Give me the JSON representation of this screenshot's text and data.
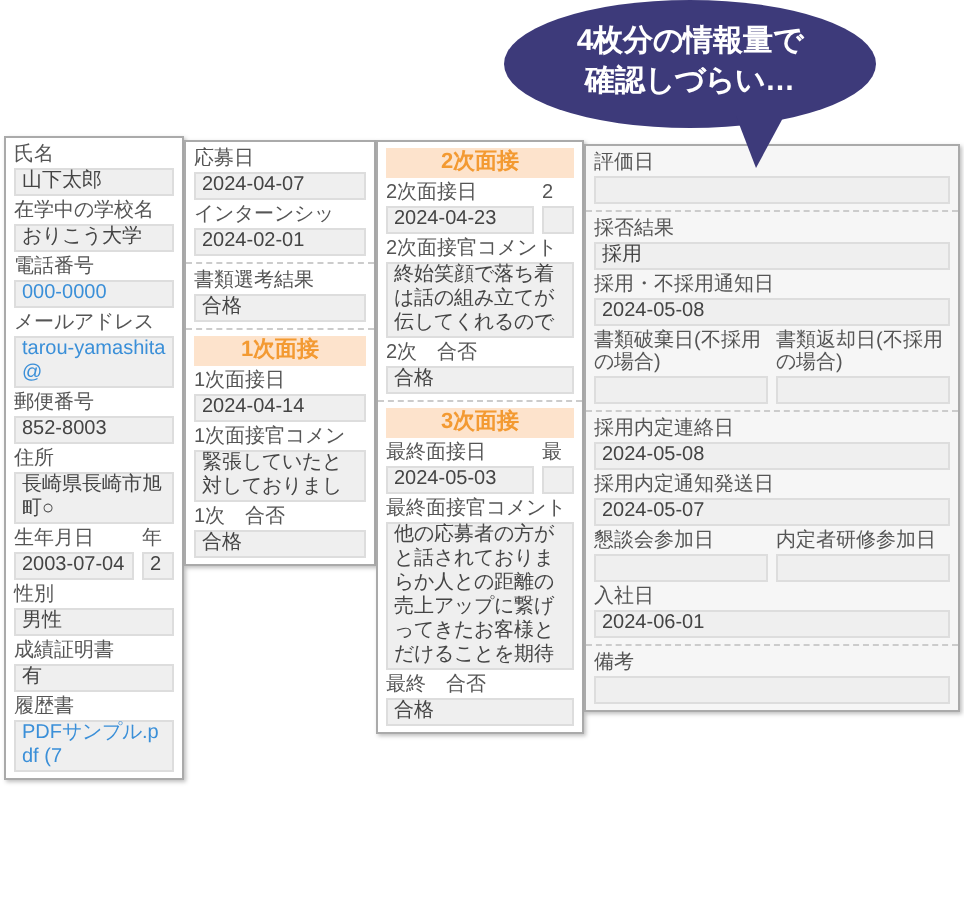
{
  "callout": {
    "lines": [
      "4枚分の情報量で",
      "確認しづらい…"
    ]
  },
  "panels": [
    {
      "sections": [
        {
          "rows": [
            {
              "fields": [
                {
                  "label": "氏名",
                  "value": "山下太郎",
                  "kind": "text"
                }
              ]
            },
            {
              "fields": [
                {
                  "label": "在学中の学校名",
                  "value": "おりこう大学",
                  "kind": "text"
                }
              ]
            },
            {
              "fields": [
                {
                  "label": "電話番号",
                  "value": "000-0000",
                  "kind": "link"
                }
              ]
            },
            {
              "fields": [
                {
                  "label": "メールアドレス",
                  "value": "tarou-yamashita@",
                  "kind": "link"
                }
              ]
            },
            {
              "fields": [
                {
                  "label": "郵便番号",
                  "value": "852-8003",
                  "kind": "text"
                }
              ]
            },
            {
              "fields": [
                {
                  "label": "住所",
                  "value": "長崎県長崎市旭町○",
                  "kind": "text"
                }
              ]
            },
            {
              "fields": [
                {
                  "label": "生年月日",
                  "value": "2003-07-04",
                  "kind": "text"
                },
                {
                  "label": "年",
                  "value": "2",
                  "kind": "text"
                }
              ]
            },
            {
              "fields": [
                {
                  "label": "性別",
                  "value": "男性",
                  "kind": "text"
                }
              ]
            },
            {
              "fields": [
                {
                  "label": "成績証明書",
                  "value": "有",
                  "kind": "text"
                }
              ]
            },
            {
              "fields": [
                {
                  "label": "履歴書",
                  "value": "PDFサンプル.pdf (7",
                  "kind": "link"
                }
              ]
            }
          ]
        }
      ]
    },
    {
      "sections": [
        {
          "rows": [
            {
              "fields": [
                {
                  "label": "応募日",
                  "value": "2024-04-07",
                  "kind": "text"
                }
              ]
            },
            {
              "fields": [
                {
                  "label": "インターンシッ",
                  "value": "2024-02-01",
                  "kind": "text"
                }
              ]
            }
          ]
        },
        {
          "rows": [
            {
              "fields": [
                {
                  "label": "書類選考結果",
                  "value": "合格",
                  "kind": "text"
                }
              ]
            }
          ]
        },
        {
          "header": "1次面接",
          "rows": [
            {
              "fields": [
                {
                  "label": "1次面接日",
                  "value": "2024-04-14",
                  "kind": "text"
                }
              ]
            },
            {
              "fields": [
                {
                  "label": "1次面接官コメン",
                  "lines": [
                    "緊張していたと",
                    "対しておりまし"
                  ],
                  "kind": "comment"
                }
              ]
            },
            {
              "fields": [
                {
                  "label": "1次　合否",
                  "value": "合格",
                  "kind": "text"
                }
              ]
            }
          ]
        }
      ]
    },
    {
      "sections": [
        {
          "header": "2次面接",
          "rows": [
            {
              "fields": [
                {
                  "label": "2次面接日",
                  "value": "2024-04-23",
                  "kind": "text"
                },
                {
                  "label": "2",
                  "kind": "text"
                }
              ]
            },
            {
              "fields": [
                {
                  "label": "2次面接官コメント",
                  "lines": [
                    "終始笑顔で落ち着",
                    "は話の組み立てが",
                    "伝してくれるので"
                  ],
                  "kind": "comment"
                }
              ]
            },
            {
              "fields": [
                {
                  "label": "2次　合否",
                  "value": "合格",
                  "kind": "text"
                }
              ]
            }
          ]
        },
        {
          "header": "3次面接",
          "rows": [
            {
              "fields": [
                {
                  "label": "最終面接日",
                  "value": "2024-05-03",
                  "kind": "text"
                },
                {
                  "label": "最",
                  "kind": "text"
                }
              ]
            },
            {
              "fields": [
                {
                  "label": "最終面接官コメント",
                  "lines": [
                    "他の応募者の方が",
                    "と話されておりま",
                    "らか人との距離の",
                    "売上アップに繋げ",
                    "ってきたお客様と",
                    "だけることを期待"
                  ],
                  "kind": "comment"
                }
              ]
            },
            {
              "fields": [
                {
                  "label": "最終　合否",
                  "value": "合格",
                  "kind": "text"
                }
              ]
            }
          ]
        }
      ]
    },
    {
      "sections": [
        {
          "rows": [
            {
              "fields": [
                {
                  "label": "評価日",
                  "kind": "text"
                }
              ]
            }
          ]
        },
        {
          "rows": [
            {
              "fields": [
                {
                  "label": "採否結果",
                  "value": "採用",
                  "kind": "text"
                }
              ]
            },
            {
              "fields": [
                {
                  "label": "採用・不採用通知日",
                  "value": "2024-05-08",
                  "kind": "text"
                }
              ]
            },
            {
              "fields": [
                {
                  "label": "書類破棄日(不採用の場合)",
                  "kind": "text"
                },
                {
                  "label": "書類返却日(不採用の場合)",
                  "kind": "text"
                }
              ]
            }
          ]
        },
        {
          "rows": [
            {
              "fields": [
                {
                  "label": "採用内定連絡日",
                  "value": "2024-05-08",
                  "kind": "text"
                }
              ]
            },
            {
              "fields": [
                {
                  "label": "採用内定通知発送日",
                  "value": "2024-05-07",
                  "kind": "text"
                }
              ]
            },
            {
              "fields": [
                {
                  "label": "懇談会参加日",
                  "kind": "text"
                },
                {
                  "label": "内定者研修参加日",
                  "kind": "text"
                }
              ]
            },
            {
              "fields": [
                {
                  "label": "入社日",
                  "value": "2024-06-01",
                  "kind": "text"
                }
              ]
            }
          ]
        },
        {
          "rows": [
            {
              "fields": [
                {
                  "label": "備考",
                  "kind": "text"
                }
              ]
            }
          ]
        }
      ]
    }
  ]
}
